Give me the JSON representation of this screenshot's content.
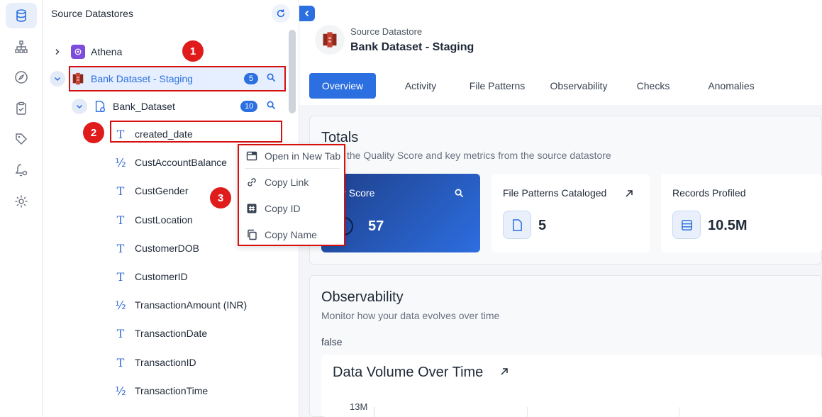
{
  "tree": {
    "title": "Source Datastores",
    "items": [
      {
        "label": "Athena"
      },
      {
        "label": "Bank Dataset - Staging",
        "count": "5"
      },
      {
        "label": "Bank_Dataset",
        "count": "10"
      }
    ],
    "columns": [
      {
        "type": "T",
        "label": "created_date"
      },
      {
        "type": "½",
        "label": "CustAccountBalance"
      },
      {
        "type": "T",
        "label": "CustGender"
      },
      {
        "type": "T",
        "label": "CustLocation"
      },
      {
        "type": "T",
        "label": "CustomerDOB"
      },
      {
        "type": "T",
        "label": "CustomerID"
      },
      {
        "type": "½",
        "label": "TransactionAmount (INR)"
      },
      {
        "type": "T",
        "label": "TransactionDate"
      },
      {
        "type": "T",
        "label": "TransactionID"
      },
      {
        "type": "½",
        "label": "TransactionTime"
      }
    ]
  },
  "markers": [
    "1",
    "2",
    "3"
  ],
  "context_menu": {
    "items": [
      "Open in New Tab",
      "Copy Link",
      "Copy ID",
      "Copy Name"
    ]
  },
  "header": {
    "subtitle": "Source Datastore",
    "title": "Bank Dataset - Staging"
  },
  "tabs": [
    "Overview",
    "Activity",
    "File Patterns",
    "Observability",
    "Checks",
    "Anomalies"
  ],
  "totals": {
    "title": "Totals",
    "subtitle": "the Quality Score and key metrics from the source datastore",
    "quality_label": "ality Score",
    "quality_value": "57",
    "file_patterns_label": "File Patterns Cataloged",
    "file_patterns_value": "5",
    "records_label": "Records Profiled",
    "records_value": "10.5M"
  },
  "observability": {
    "title": "Observability",
    "subtitle": "Monitor how your data evolves over time",
    "flag": "false",
    "chart_title": "Data Volume Over Time",
    "axis_top": "13M"
  },
  "colors": {
    "accent": "#2b6fe0",
    "annotation": "#d60f0f"
  }
}
